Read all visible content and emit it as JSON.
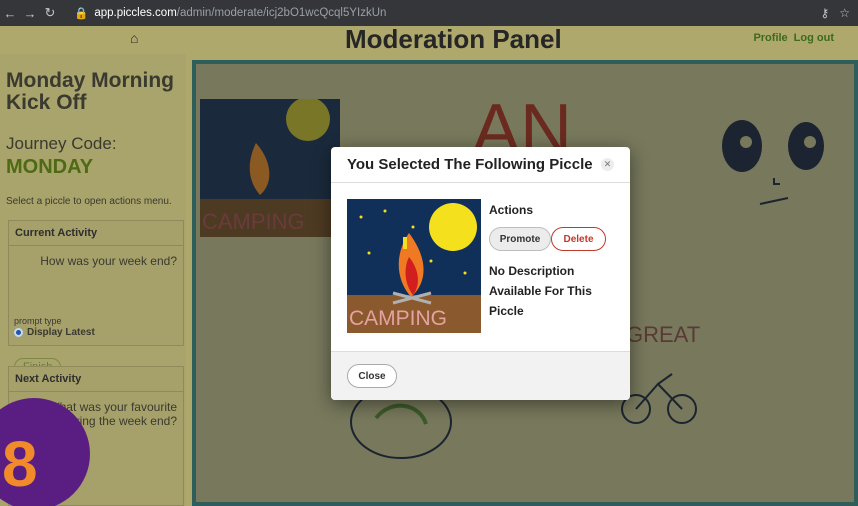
{
  "browser": {
    "back_icon": "back-arrow-icon",
    "forward_icon": "forward-arrow-icon",
    "reload_icon": "reload-icon",
    "url_domain": "app.piccles.com",
    "url_path": "/admin/moderate/icj2bO1wcQcql5YIzkUn"
  },
  "app": {
    "panel_title": "Moderation Panel",
    "profile_link": "Profile",
    "logout_link": "Log out"
  },
  "sidebar": {
    "journey_title": "Monday Morning Kick Off",
    "code_label": "Journey Code:",
    "code_value": "MONDAY",
    "hint": "Select a piccle to open actions menu.",
    "current_activity_label": "Current Activity",
    "current_activity_prompt": "How was your week end?",
    "prompt_type_label": "prompt type",
    "prompt_type_value": "Display Latest",
    "finish_label": "Finish",
    "next_activity_label": "Next Activity",
    "next_activity_prompt": "What was your favourite",
    "next_activity_prompt_2": "during the week end?"
  },
  "modal": {
    "title": "You Selected The Following Piccle",
    "actions_label": "Actions",
    "promote_label": "Promote",
    "delete_label": "Delete",
    "description": "No Description Available For This Piccle",
    "close_label": "Close",
    "thumb_text": "CAMPING"
  },
  "drawings": {
    "camping_text": "CAMPING",
    "an_text": "AN",
    "great_text": "GREAT"
  },
  "step": {
    "number": "8"
  },
  "colors": {
    "accent_green": "#4f6a14",
    "step_circle": "#5a1e82",
    "step_number": "#f08a2a",
    "delete_red": "#c0392b"
  }
}
